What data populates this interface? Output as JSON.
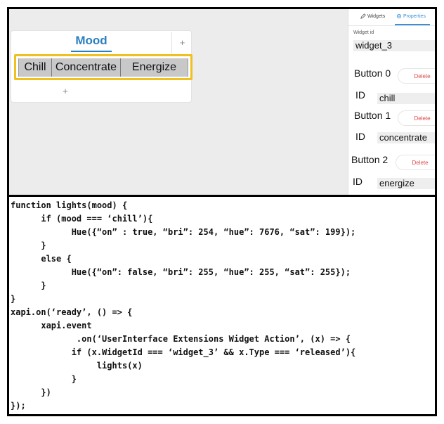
{
  "canvas": {
    "page_tab_title": "Mood",
    "add_page_symbol": "+",
    "add_row_symbol": "+",
    "button_group": [
      "Chill",
      "Concentrate",
      "Energize"
    ]
  },
  "sidebar": {
    "tabs": {
      "widgets": "Widgets",
      "properties": "Properties"
    },
    "widget_id_label": "Widget id",
    "widget_id_value": "widget_3",
    "buttons": [
      {
        "label": "Button 0",
        "delete": "Delete",
        "id_label": "ID",
        "id_value": "chill"
      },
      {
        "label": "Button 1",
        "delete": "Delete",
        "id_label": "ID",
        "id_value": "concentrate"
      },
      {
        "label": "Button 2",
        "delete": "Delete",
        "id_label": "ID",
        "id_value": "energize"
      }
    ]
  },
  "code": {
    "lines": [
      "function lights(mood) {",
      "      if (mood === ‘chill’){",
      "            Hue({“on” : true, “bri”: 254, “hue”: 7676, “sat”: 199});",
      "      }",
      "      else {",
      "            Hue({“on”: false, “bri”: 255, “hue”: 255, “sat”: 255});",
      "      }",
      "}",
      "xapi.on(‘ready’, () => {",
      "      xapi.event",
      "             .on(‘UserInterface Extensions Widget Action’, (x) => {",
      "            if (x.WidgetId === ‘widget_3’ && x.Type === ‘released’){",
      "                 lights(x)",
      "            }",
      "      })",
      "});"
    ]
  },
  "colors": {
    "accent_blue": "#2a7fc0",
    "selection_yellow": "#f0c020",
    "delete_red": "#e04848",
    "canvas_gray": "#ececec"
  }
}
